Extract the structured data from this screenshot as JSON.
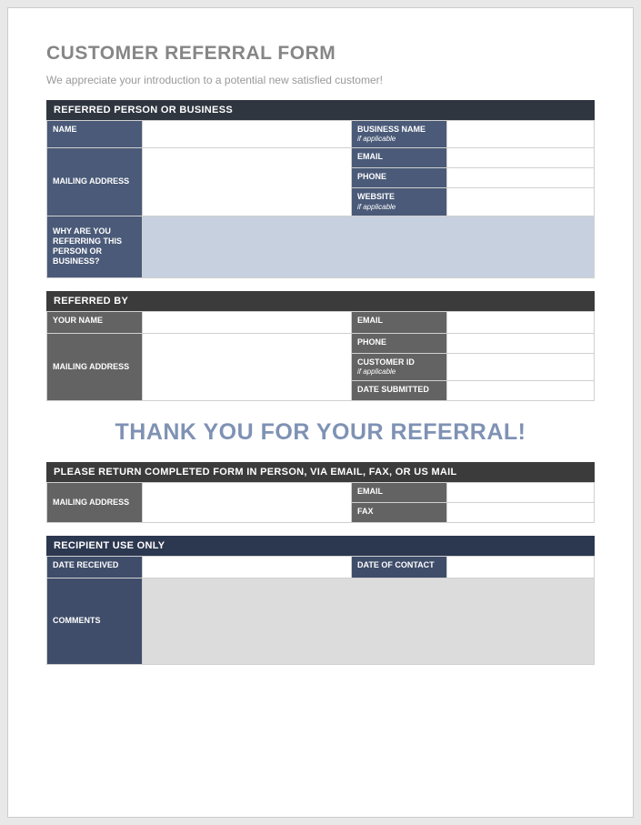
{
  "title": "CUSTOMER REFERRAL FORM",
  "subtitle": "We appreciate your introduction to a potential new satisfied customer!",
  "section1": {
    "header": "REFERRED PERSON OR BUSINESS",
    "name": "NAME",
    "mailing": "MAILING ADDRESS",
    "business": "BUSINESS NAME",
    "business_note": "if applicable",
    "email": "EMAIL",
    "phone": "PHONE",
    "website": "WEBSITE",
    "website_note": "if applicable",
    "why": "WHY ARE YOU REFERRING THIS PERSON OR BUSINESS?"
  },
  "section2": {
    "header": "REFERRED BY",
    "yourname": "YOUR NAME",
    "mailing": "MAILING ADDRESS",
    "email": "EMAIL",
    "phone": "PHONE",
    "custid": "CUSTOMER ID",
    "custid_note": "if applicable",
    "date": "DATE SUBMITTED"
  },
  "thankyou": "THANK YOU FOR YOUR REFERRAL!",
  "section3": {
    "header": "PLEASE RETURN COMPLETED FORM IN PERSON, VIA EMAIL, FAX, OR US MAIL",
    "mailing": "MAILING ADDRESS",
    "email": "EMAIL",
    "fax": "FAX"
  },
  "section4": {
    "header": "RECIPIENT USE ONLY",
    "received": "DATE RECEIVED",
    "contact": "DATE OF CONTACT",
    "comments": "COMMENTS"
  }
}
